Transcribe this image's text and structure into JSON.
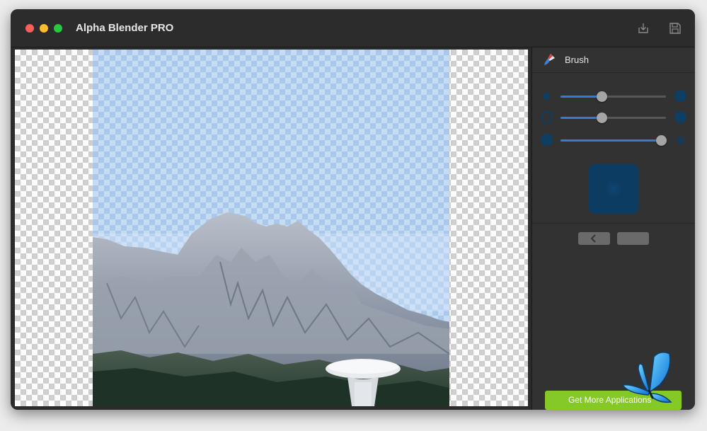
{
  "window": {
    "title": "Alpha Blender PRO"
  },
  "toolbar": {
    "import_icon": "tray-download-icon",
    "save_icon": "floppy-disk-icon"
  },
  "panel": {
    "title": "Brush",
    "icon": "brush-icon",
    "sliders": [
      {
        "name": "brush-size",
        "value": 0.39
      },
      {
        "name": "brush-softness",
        "value": 0.39
      },
      {
        "name": "brush-opacity",
        "value": 0.95
      }
    ],
    "nav_prev_icon": "chevron-left-icon"
  },
  "footer": {
    "get_more_label": "Get More Applications"
  },
  "colors": {
    "accent": "#2f7ce0",
    "brush_dot": "#0d3e64",
    "get_more_bg": "#84c928",
    "mask_tint": "#9fc6ef"
  }
}
